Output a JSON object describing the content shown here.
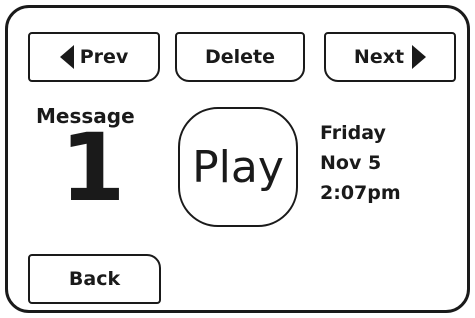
{
  "nav": {
    "prev_label": "Prev",
    "delete_label": "Delete",
    "next_label": "Next",
    "prev_icon": "triangle-left-icon",
    "next_icon": "triangle-right-icon"
  },
  "message": {
    "label": "Message",
    "number": "1"
  },
  "player": {
    "play_label": "Play"
  },
  "timestamp": {
    "day": "Friday",
    "date": "Nov 5",
    "time": "2:07pm"
  },
  "footer": {
    "back_label": "Back"
  }
}
